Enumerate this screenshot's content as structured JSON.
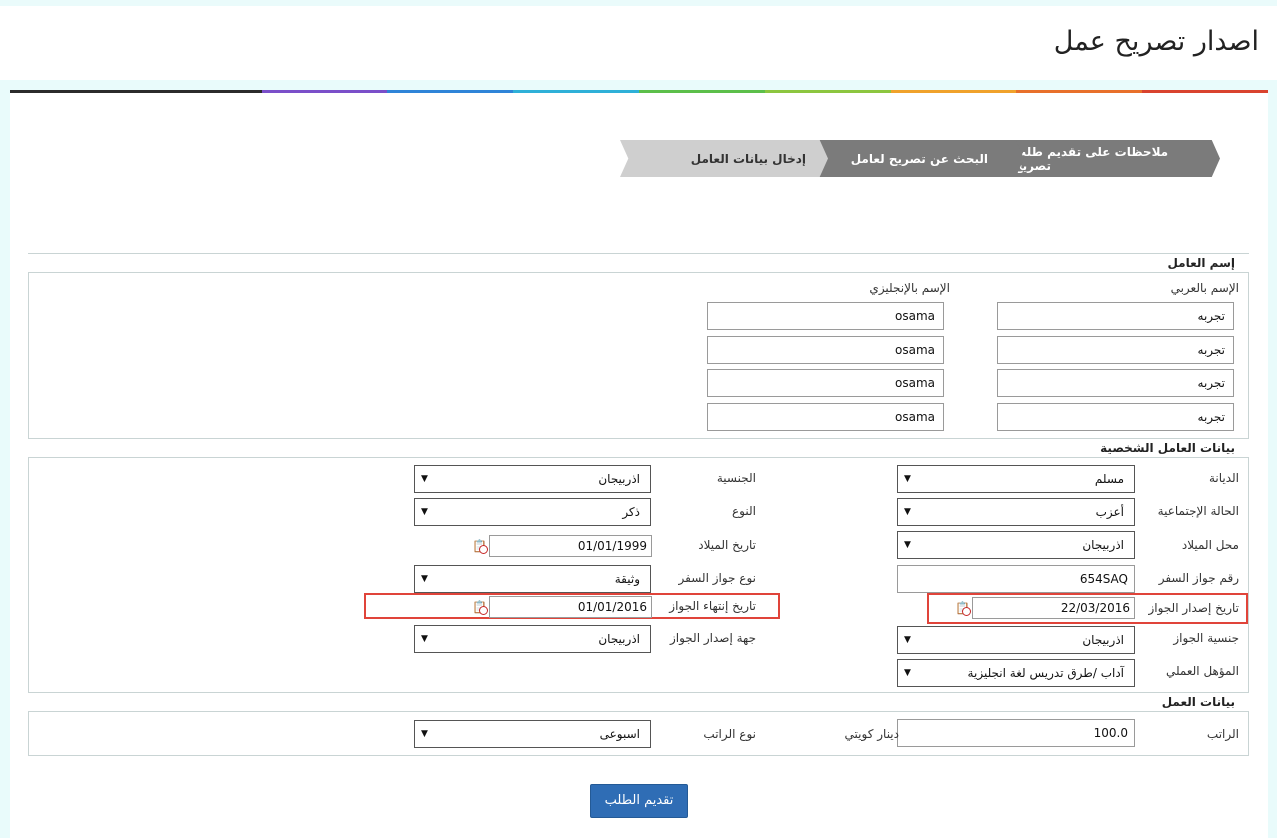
{
  "page": {
    "title": "اصدار تصريح عمل"
  },
  "steps": [
    {
      "label": "ملاحظات على تقديم طلب تصريح"
    },
    {
      "label": "البحث عن تصريح لعامل"
    },
    {
      "label": "إدخال بيانات العامل"
    }
  ],
  "worker_name": {
    "section_title": "إسم العامل",
    "arabic_label": "الإسم بالعربي",
    "english_label": "الإسم بالإنجليزي",
    "arabic_names": [
      "تجربه",
      "تجربه",
      "تجربه",
      "تجربه"
    ],
    "english_names": [
      "osama",
      "osama",
      "osama",
      "osama"
    ]
  },
  "personal": {
    "section_title": "بيانات العامل الشخصية",
    "religion": {
      "label": "الديانة",
      "value": "مسلم"
    },
    "nationality": {
      "label": "الجنسية",
      "value": "اذربيجان"
    },
    "marital_status": {
      "label": "الحالة الإجتماعية",
      "value": "أعزب"
    },
    "gender": {
      "label": "النوع",
      "value": "ذكر"
    },
    "birth_place": {
      "label": "محل الميلاد",
      "value": "اذربيجان"
    },
    "birth_date": {
      "label": "تاريخ الميلاد",
      "value": "01/01/1999"
    },
    "passport_no": {
      "label": "رقم جواز السفر",
      "value": "654SAQ"
    },
    "passport_type": {
      "label": "نوع جواز السفر",
      "value": "وثيقة"
    },
    "passport_issue_date": {
      "label": "تاريخ إصدار الجواز",
      "value": "22/03/2016"
    },
    "passport_expiry_date": {
      "label": "تاريخ إنتهاء الجواز",
      "value": "01/01/2016"
    },
    "passport_nationality": {
      "label": "جنسية الجواز",
      "value": "اذربيجان"
    },
    "passport_issuer": {
      "label": "جهة إصدار الجواز",
      "value": "اذربيجان"
    },
    "qualification": {
      "label": "المؤهل العملي",
      "value": "آداب /طرق تدريس لغة انجليزية"
    }
  },
  "work": {
    "section_title": "بيانات العمل",
    "salary": {
      "label": "الراتب",
      "value": "100.0",
      "currency": "دينار كويتي"
    },
    "salary_type": {
      "label": "نوع الراتب",
      "value": "اسبوعى"
    }
  },
  "submit_label": "تقديم الطلب",
  "colors": {
    "rule": [
      "#2b2b2b",
      "#2b2b2b",
      "#7a4fc9",
      "#2e84d8",
      "#2eb0d8",
      "#5cbf4a",
      "#8cc63f",
      "#f0a22b",
      "#e8702a",
      "#d9432e"
    ],
    "highlight": "#e0443a",
    "submit": "#2f6db5"
  }
}
